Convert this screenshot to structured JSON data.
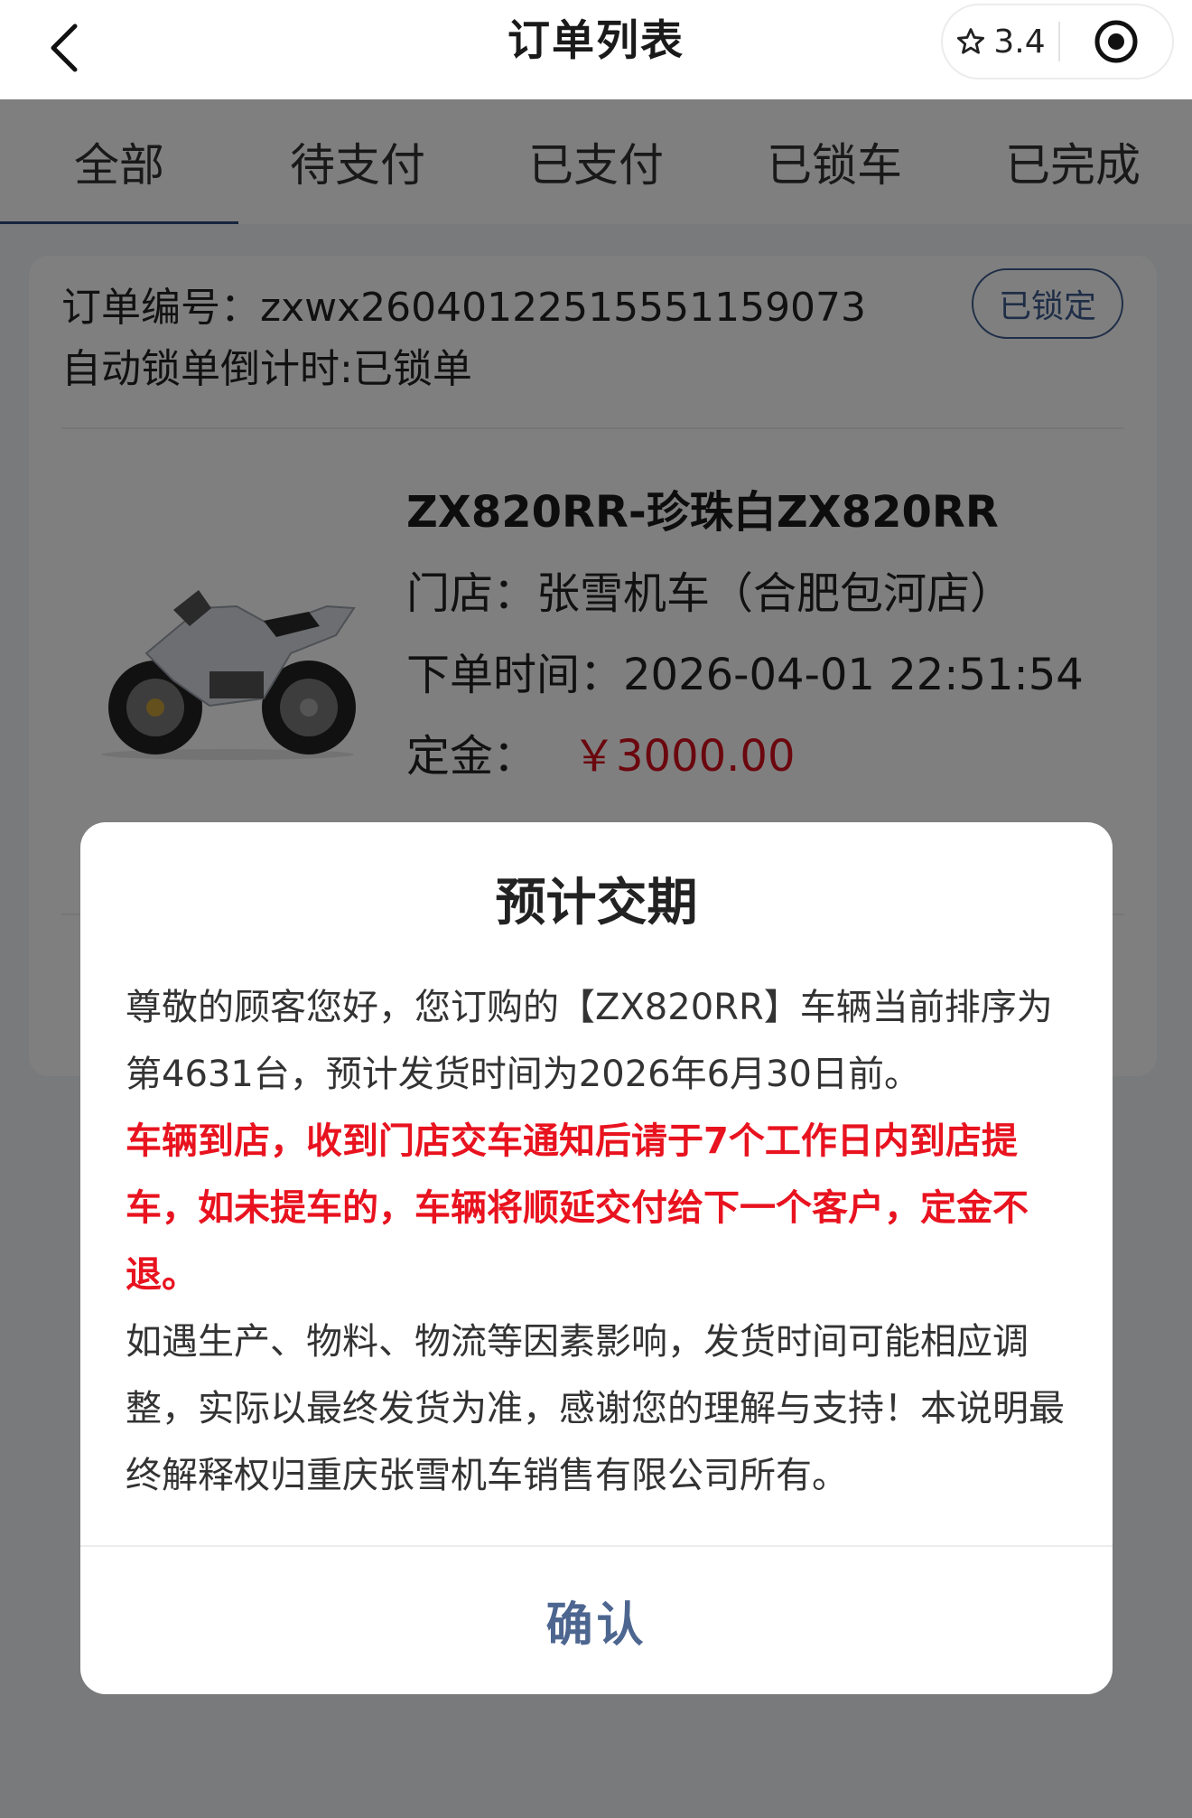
{
  "header": {
    "title": "订单列表",
    "rating": "3.4"
  },
  "tabs": [
    {
      "label": "全部",
      "active": true
    },
    {
      "label": "待支付",
      "active": false
    },
    {
      "label": "已支付",
      "active": false
    },
    {
      "label": "已锁车",
      "active": false
    },
    {
      "label": "已完成",
      "active": false
    }
  ],
  "order": {
    "order_no_label": "订单编号：",
    "order_no": "zxwx26040122515551159073",
    "countdown": "自动锁单倒计时:已锁单",
    "status": "已锁定",
    "product_name": "ZX820RR-珍珠白ZX820RR",
    "store_label": "门店：",
    "store": "张雪机车（合肥包河店）",
    "time_label": "下单时间：",
    "time": "2026-04-01 22:51:54",
    "deposit_label": "定金：",
    "deposit": "￥3000.00"
  },
  "modal": {
    "title": "预计交期",
    "para1": "尊敬的顾客您好，您订购的【ZX820RR】车辆当前排序为第4631台，预计发货时间为2026年6月30日前。",
    "warning": "车辆到店，收到门店交车通知后请于7个工作日内到店提车，如未提车的，车辆将顺延交付给下一个客户，定金不退。",
    "para2": "如遇生产、物料、物流等因素影响，发货时间可能相应调整，实际以最终发货为准，感谢您的理解与支持！本说明最终解释权归重庆张雪机车销售有限公司所有。",
    "confirm_label": "确认"
  },
  "colors": {
    "accent": "#3f5d8e",
    "price": "#d60f1c",
    "warning": "#e8131f",
    "confirm": "#4d6690"
  }
}
